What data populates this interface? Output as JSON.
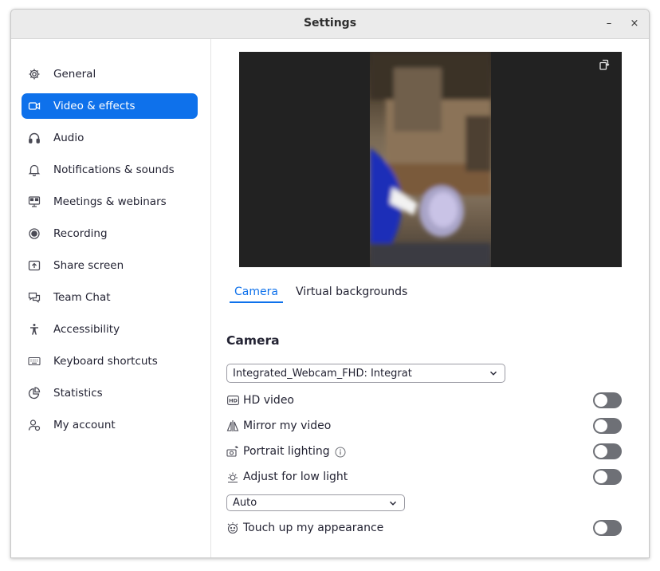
{
  "window": {
    "title": "Settings",
    "minimize_label": "–",
    "close_label": "×"
  },
  "sidebar": {
    "items": [
      {
        "label": "General",
        "icon": "gear-icon",
        "active": false
      },
      {
        "label": "Video & effects",
        "icon": "video-camera-icon",
        "active": true
      },
      {
        "label": "Audio",
        "icon": "headphones-icon",
        "active": false
      },
      {
        "label": "Notifications & sounds",
        "icon": "bell-icon",
        "active": false
      },
      {
        "label": "Meetings & webinars",
        "icon": "meeting-icon",
        "active": false
      },
      {
        "label": "Recording",
        "icon": "record-icon",
        "active": false
      },
      {
        "label": "Share screen",
        "icon": "share-screen-icon",
        "active": false
      },
      {
        "label": "Team Chat",
        "icon": "chat-icon",
        "active": false
      },
      {
        "label": "Accessibility",
        "icon": "accessibility-icon",
        "active": false
      },
      {
        "label": "Keyboard shortcuts",
        "icon": "keyboard-icon",
        "active": false
      },
      {
        "label": "Statistics",
        "icon": "pie-chart-icon",
        "active": false
      },
      {
        "label": "My account",
        "icon": "account-icon",
        "active": false
      }
    ]
  },
  "tabs": [
    {
      "label": "Camera",
      "active": true
    },
    {
      "label": "Virtual backgrounds",
      "active": false
    }
  ],
  "camera": {
    "section_title": "Camera",
    "device_select": {
      "value": "Integrated_Webcam_FHD: Integrat"
    },
    "options": [
      {
        "label": "HD video",
        "icon": "hd-icon",
        "on": false
      },
      {
        "label": "Mirror my video",
        "icon": "mirror-icon",
        "on": false
      },
      {
        "label": "Portrait lighting",
        "icon": "portrait-lighting-icon",
        "on": false,
        "info": true
      },
      {
        "label": "Adjust for low light",
        "icon": "brightness-icon",
        "on": false
      }
    ],
    "low_light_select": {
      "value": "Auto"
    },
    "touch_up": {
      "label": "Touch up my appearance",
      "icon": "smile-face-icon",
      "on": false
    }
  },
  "colors": {
    "accent": "#0e71eb",
    "toggle_off": "#6e7076",
    "text": "#232333"
  }
}
